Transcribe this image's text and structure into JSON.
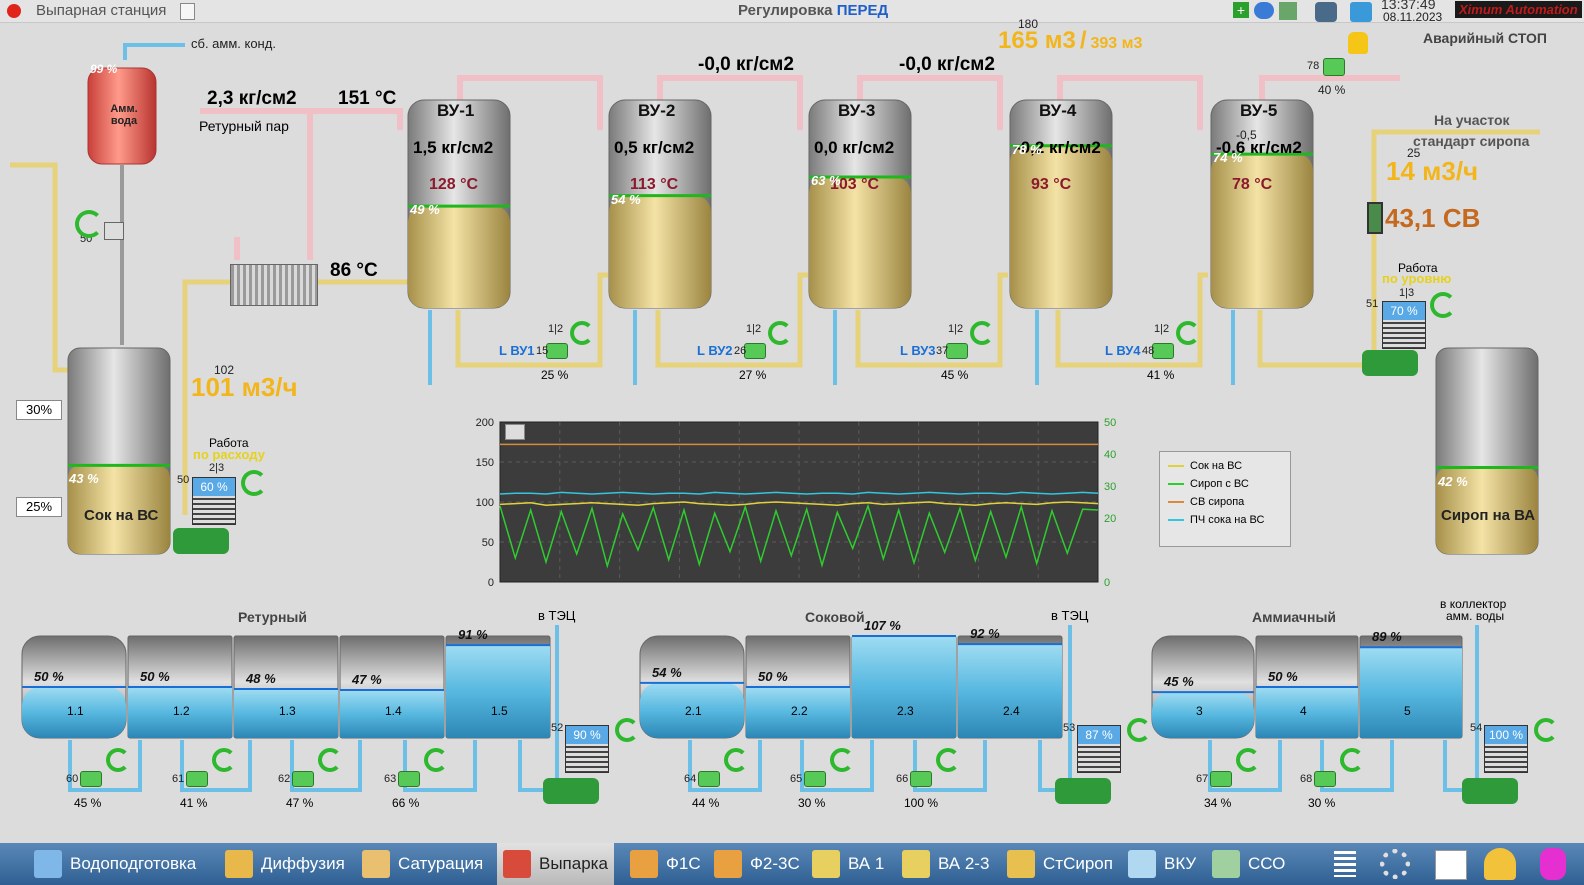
{
  "window": {
    "title": "Выпарная станция",
    "mode_prefix": "Регулировка",
    "mode_value": "ПЕРЕД",
    "time": "13:37:49",
    "date": "08.11.2023",
    "brand": "Ximum Automation",
    "emergency_stop": "Аварийный СТОП"
  },
  "flows": {
    "total_small": "180",
    "total_main": "165 м3",
    "total_sep": "/",
    "total_target": "393 м3",
    "juice_small": "102",
    "juice_main": "101 м3/ч",
    "syrup_small": "25",
    "syrup_main": "14 м3/ч",
    "syrup_cb": "43,1 СВ",
    "to_section_1": "На участок",
    "to_section_2": "стандарт сиропа",
    "syrup_cb_small": "-0,5"
  },
  "steam": {
    "pressure": "2,3 кг/см2",
    "temp": "151 °С",
    "label": "Ретурный пар",
    "heater_temp": "86 °С"
  },
  "amm": {
    "tank_label": "Амм. вода",
    "tank_pct": "99 %",
    "cond_label": "сб. амм. конд.",
    "valve_val": "50"
  },
  "links": {
    "p12": "-0,0 кг/см2",
    "p23": "-0,0 кг/см2"
  },
  "evaporators": [
    {
      "name": "ВУ-1",
      "pressure": "1,5 кг/см2",
      "temp": "128 °С",
      "level": "49 %",
      "level_num": 0.49
    },
    {
      "name": "ВУ-2",
      "pressure": "0,5 кг/см2",
      "temp": "113 °С",
      "level": "54 %",
      "level_num": 0.54
    },
    {
      "name": "ВУ-3",
      "pressure": "0,0 кг/см2",
      "temp": "103 °С",
      "level": "63 %",
      "level_num": 0.63
    },
    {
      "name": "ВУ-4",
      "pressure": "-0,2 кг/см2",
      "temp": "93 °С",
      "level": "78 %",
      "level_num": 0.78
    },
    {
      "name": "ВУ-5",
      "pressure": "-0,6 кг/см2",
      "temp": "78 °С",
      "level": "74 %",
      "level_num": 0.74
    }
  ],
  "level_valves": [
    {
      "label": "L ВУ1",
      "num": "15",
      "mode": "1|2",
      "pct": "25 %"
    },
    {
      "label": "L ВУ2",
      "num": "26",
      "mode": "1|2",
      "pct": "27 %"
    },
    {
      "label": "L ВУ3",
      "num": "37",
      "mode": "1|2",
      "pct": "45 %"
    },
    {
      "label": "L ВУ4",
      "num": "48",
      "mode": "1|2",
      "pct": "41 %"
    }
  ],
  "vu5_valve": {
    "num": "78",
    "pct": "40 %"
  },
  "tanks": {
    "juice": {
      "label": "Сок на ВС",
      "level": "43 %",
      "level_num": 0.43,
      "hi": "30%",
      "lo": "25%"
    },
    "syrup": {
      "label": "Сироп на ВА",
      "level": "42 %",
      "level_num": 0.42
    }
  },
  "pumps": {
    "juice": {
      "work": "Работа",
      "mode": "по расходу",
      "sel": "2|3",
      "num": "50",
      "pct": "60 %"
    },
    "syrup": {
      "work": "Работа",
      "mode": "по уровню",
      "sel": "1|3",
      "num": "51",
      "pct": "70 %"
    }
  },
  "chart_data": {
    "type": "line",
    "y_left": [
      0,
      50,
      100,
      150,
      200
    ],
    "y_right": [
      20,
      30,
      40,
      50
    ],
    "y_right_zero": "0",
    "ylim_left": [
      0,
      200
    ],
    "ylim_right": [
      0,
      50
    ],
    "series": [
      {
        "name": "Сок на ВС",
        "color": "#e0d23c",
        "values": [
          97,
          98,
          99,
          96,
          97,
          98,
          99,
          98,
          97,
          96,
          98,
          99,
          100,
          98,
          97,
          96,
          97,
          99,
          100,
          99,
          98,
          97,
          96,
          98,
          99,
          97,
          98,
          99,
          100,
          98,
          97,
          96,
          98,
          99,
          98,
          97,
          99,
          100,
          99,
          98
        ]
      },
      {
        "name": "Сироп с ВС",
        "color": "#2ecc2e",
        "values": [
          95,
          30,
          90,
          25,
          88,
          35,
          92,
          20,
          85,
          40,
          93,
          28,
          90,
          22,
          86,
          38,
          94,
          26,
          89,
          33,
          91,
          21,
          87,
          42,
          95,
          29,
          90,
          24,
          86,
          37,
          92,
          27,
          88,
          31,
          94,
          23,
          89,
          36,
          91,
          90
        ]
      },
      {
        "name": "СВ сиропа",
        "color": "#d98a3a",
        "values": [
          43,
          43,
          43,
          43,
          43,
          43,
          43,
          43,
          43,
          43,
          43,
          43,
          43,
          43,
          43,
          43,
          43,
          43,
          43,
          43,
          43,
          43,
          43,
          43,
          43,
          43,
          43,
          43,
          43,
          43,
          43,
          43,
          43,
          43,
          43,
          43,
          43,
          43,
          43,
          43
        ]
      },
      {
        "name": "ПЧ сока на ВС",
        "color": "#33c6e0",
        "values": [
          110,
          111,
          111,
          110,
          112,
          111,
          110,
          111,
          112,
          111,
          110,
          111,
          111,
          110,
          112,
          111,
          110,
          111,
          112,
          111,
          110,
          111,
          111,
          110,
          112,
          111,
          110,
          111,
          112,
          111,
          110,
          111,
          111,
          110,
          112,
          111,
          110,
          111,
          112,
          111
        ]
      }
    ]
  },
  "groups": {
    "returny": {
      "title": "Ретурный",
      "to": "в ТЭЦ",
      "pump_num": "52",
      "pump_pct": "90 %",
      "tanks": [
        {
          "id": "1.1",
          "level": "50 %"
        },
        {
          "id": "1.2",
          "level": "50 %"
        },
        {
          "id": "1.3",
          "level": "48 %"
        },
        {
          "id": "1.4",
          "level": "47 %"
        },
        {
          "id": "1.5",
          "level": "91 %"
        }
      ],
      "valves": [
        {
          "num": "60",
          "pct": "45 %"
        },
        {
          "num": "61",
          "pct": "41 %"
        },
        {
          "num": "62",
          "pct": "47 %"
        },
        {
          "num": "63",
          "pct": "66 %"
        }
      ]
    },
    "sokovoy": {
      "title": "Соковой",
      "to": "в ТЭЦ",
      "pump_num": "53",
      "pump_pct": "87 %",
      "tanks": [
        {
          "id": "2.1",
          "level": "54 %"
        },
        {
          "id": "2.2",
          "level": "50 %"
        },
        {
          "id": "2.3",
          "level": "107 %"
        },
        {
          "id": "2.4",
          "level": "92 %"
        }
      ],
      "valves": [
        {
          "num": "64",
          "pct": "44 %"
        },
        {
          "num": "65",
          "pct": "30 %"
        },
        {
          "num": "66",
          "pct": "100 %"
        }
      ]
    },
    "ammiachny": {
      "title": "Аммиачный",
      "to1": "в коллектор",
      "to2": "амм. воды",
      "pump_num": "54",
      "pump_pct": "100 %",
      "tanks": [
        {
          "id": "3",
          "level": "45 %"
        },
        {
          "id": "4",
          "level": "50 %"
        },
        {
          "id": "5",
          "level": "89 %"
        }
      ],
      "valves": [
        {
          "num": "67",
          "pct": "34 %"
        },
        {
          "num": "68",
          "pct": "30 %"
        }
      ]
    }
  },
  "taskbar": [
    {
      "label": "Водоподготовка",
      "color": "#7fb8e8"
    },
    {
      "label": "Диффузия",
      "color": "#e8b84a"
    },
    {
      "label": "Сатурация",
      "color": "#e8c070"
    },
    {
      "label": "Выпарка",
      "color": "#d84a3a",
      "active": true
    },
    {
      "label": "Ф1С",
      "color": "#e8a040"
    },
    {
      "label": "Ф2-3С",
      "color": "#e8a040"
    },
    {
      "label": "ВА 1",
      "color": "#e8d060"
    },
    {
      "label": "ВА 2-3",
      "color": "#e8d060"
    },
    {
      "label": "СтСироп",
      "color": "#e8c050"
    },
    {
      "label": "ВКУ",
      "color": "#b0d8f0"
    },
    {
      "label": "ССО",
      "color": "#a0d0a0"
    }
  ]
}
